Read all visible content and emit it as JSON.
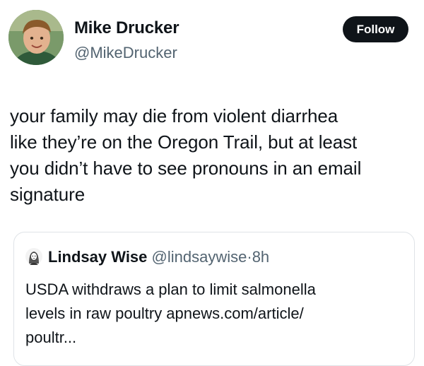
{
  "tweet": {
    "author": {
      "name": "Mike Drucker",
      "handle": "@MikeDrucker"
    },
    "follow_label": "Follow",
    "text_lines": [
      "your family may die from violent diarrhea",
      "like they’re on the Oregon Trail, but at least",
      "you didn’t have to see pronouns in an email",
      "signature"
    ]
  },
  "quote": {
    "author": {
      "name": "Lindsay Wise",
      "handle": "@lindsaywise",
      "separator": "·",
      "time": "8h"
    },
    "text_lines": [
      "USDA withdraws a plan to limit salmonella",
      "levels in raw poultry apnews.com/article/",
      "poultr..."
    ]
  },
  "icons": {
    "author_avatar": "child-photo-avatar",
    "quote_avatar": "woman-sketch-avatar"
  },
  "colors": {
    "text": "#0f1419",
    "secondary": "#536471",
    "button_bg": "#0f1419",
    "button_text": "#ffffff",
    "card_border": "#dfe3e7"
  }
}
